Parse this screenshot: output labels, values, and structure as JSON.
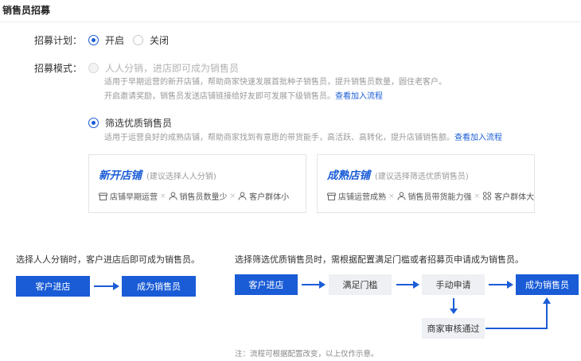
{
  "header": {
    "title": "销售员招募"
  },
  "plan": {
    "label": "招募计划：",
    "options": [
      {
        "label": "开启",
        "selected": true
      },
      {
        "label": "关闭",
        "selected": false
      }
    ]
  },
  "mode": {
    "label": "招募模式：",
    "option1": {
      "label": "人人分销，进店即可成为销售员",
      "disabled": true,
      "desc_line1": "适用于早期运营的新开店铺，帮助商家快速发展首批种子销售员，提升销售员数量，圆住老客户。",
      "desc_line2": "开启邀请奖励，销售员发送店铺链接给好友即可发展下级销售员。",
      "desc_link": "查看加入流程"
    },
    "option2": {
      "label": "筛选优质销售员",
      "selected": true,
      "desc": "适用于运营良好的成熟店铺，帮助商家找到有意愿的带货能手，高活跃、高转化，提升店铺销售额。",
      "desc_link": "查看加入流程"
    }
  },
  "cards": {
    "new_store": {
      "title": "新开店铺",
      "subtitle": "(建议选择人人分销)",
      "tags": [
        "店铺早期运营",
        "销售员数量少",
        "客户群体小"
      ],
      "tag_icons": [
        "store-icon",
        "user-icon",
        "user-icon"
      ]
    },
    "mature_store": {
      "title": "成熟店铺",
      "subtitle": "(建议选择筛选优质销售员)",
      "tags": [
        "店铺运营成熟",
        "销售员带货能力强",
        "客户群体大"
      ],
      "tag_icons": [
        "store-icon",
        "user-icon",
        "group-icon"
      ]
    },
    "separator": "×"
  },
  "flow_left": {
    "note": "选择人人分销时，客户进店后即可成为销售员。",
    "step1": "客户进店",
    "step2": "成为销售员"
  },
  "flow_right": {
    "note": "选择筛选优质销售员时，需根据配置满足门槛或者招募页申请成为销售员。",
    "step1": "客户进店",
    "step2": "满足门槛",
    "step3": "手动申请",
    "step4": "成为销售员",
    "step5": "商家审核通过"
  },
  "footnote": "注：流程可根据配置改变，以上仅作示意。",
  "colors": {
    "accent": "#1a5cd6",
    "muted": "#999999",
    "step_gray": "#eef0f3"
  }
}
